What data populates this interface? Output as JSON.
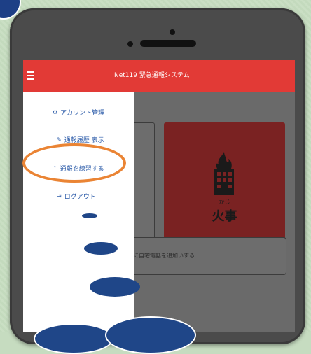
{
  "app": {
    "title": "Net119 緊急通報システム"
  },
  "drawer": {
    "items": [
      {
        "label": "アカウント管理",
        "icon": "gear-icon"
      },
      {
        "label": "通報履歴 表示",
        "icon": "history-icon"
      },
      {
        "label": "通報を練習する",
        "icon": "arrow-up-icon"
      },
      {
        "label": "ログアウト",
        "icon": "logout-icon"
      }
    ]
  },
  "main": {
    "fire_tile": {
      "kana": "かじ",
      "label": "火事"
    },
    "phone_call_text": "に自宅電話を追加いする"
  },
  "colors": {
    "appbar": "#e23a36",
    "drawer_text": "#2a5aa8",
    "fire_tile": "#7a2222",
    "highlight_ring": "#ea8434",
    "annotation_oval": "#1f4688"
  }
}
